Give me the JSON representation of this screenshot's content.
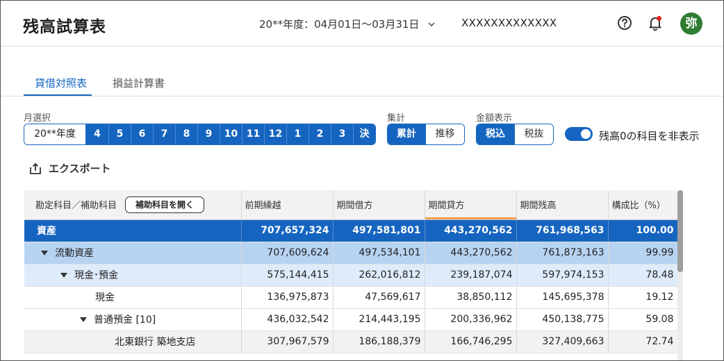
{
  "header": {
    "title": "残高試算表",
    "period": "20**年度：04月01日〜03月31日",
    "company": "XXXXXXXXXXXXX",
    "avatar_initial": "弥",
    "icons": [
      "help-icon",
      "bell-icon",
      "chevron-down-icon"
    ],
    "notification_dot_color": "#e02020"
  },
  "tabs": [
    {
      "label": "貸借対照表",
      "active": true
    },
    {
      "label": "損益計算書",
      "active": false
    }
  ],
  "filters": {
    "month_label": "月選択",
    "fiscal_year": "20**年度",
    "months": [
      "4",
      "5",
      "6",
      "7",
      "8",
      "9",
      "10",
      "11",
      "12",
      "1",
      "2",
      "3",
      "決"
    ],
    "aggregate_label": "集計",
    "aggregate_options": [
      "累計",
      "推移"
    ],
    "aggregate_selected": "累計",
    "amount_label": "金額表示",
    "amount_options": [
      "税込",
      "税抜"
    ],
    "amount_selected": "税込",
    "hide_zero_label": "残高0の科目を非表示",
    "hide_zero_on": true
  },
  "export_label": "エクスポート",
  "table": {
    "col_account": "勘定科目／補助科目",
    "open_sub_button": "補助科目を開く",
    "columns": [
      "前期繰越",
      "期間借方",
      "期間貸方",
      "期間残高",
      "構成比（%）"
    ],
    "rows": [
      {
        "name": "資産",
        "level": 0,
        "values": [
          "707,657,324",
          "497,581,801",
          "443,270,562",
          "761,968,563",
          "100.00"
        ]
      },
      {
        "name": "流動資産",
        "level": 1,
        "values": [
          "707,609,624",
          "497,534,101",
          "443,270,562",
          "761,873,163",
          "99.99"
        ]
      },
      {
        "name": "現金･預金",
        "level": 2,
        "values": [
          "575,144,415",
          "262,016,812",
          "239,187,074",
          "597,974,153",
          "78.48"
        ]
      },
      {
        "name": "現金",
        "level": 3,
        "values": [
          "136,975,873",
          "47,569,617",
          "38,850,112",
          "145,695,378",
          "19.12"
        ]
      },
      {
        "name": "普通預金 [10]",
        "level": 3,
        "values": [
          "436,032,542",
          "214,443,195",
          "200,336,962",
          "450,138,775",
          "59.08"
        ]
      },
      {
        "name": "北東銀行 築地支店",
        "level": 4,
        "values": [
          "307,967,579",
          "186,188,379",
          "166,746,295",
          "327,409,663",
          "72.74"
        ]
      }
    ]
  },
  "colors": {
    "accent": "#1565c0",
    "avatar": "#2e7d32"
  }
}
